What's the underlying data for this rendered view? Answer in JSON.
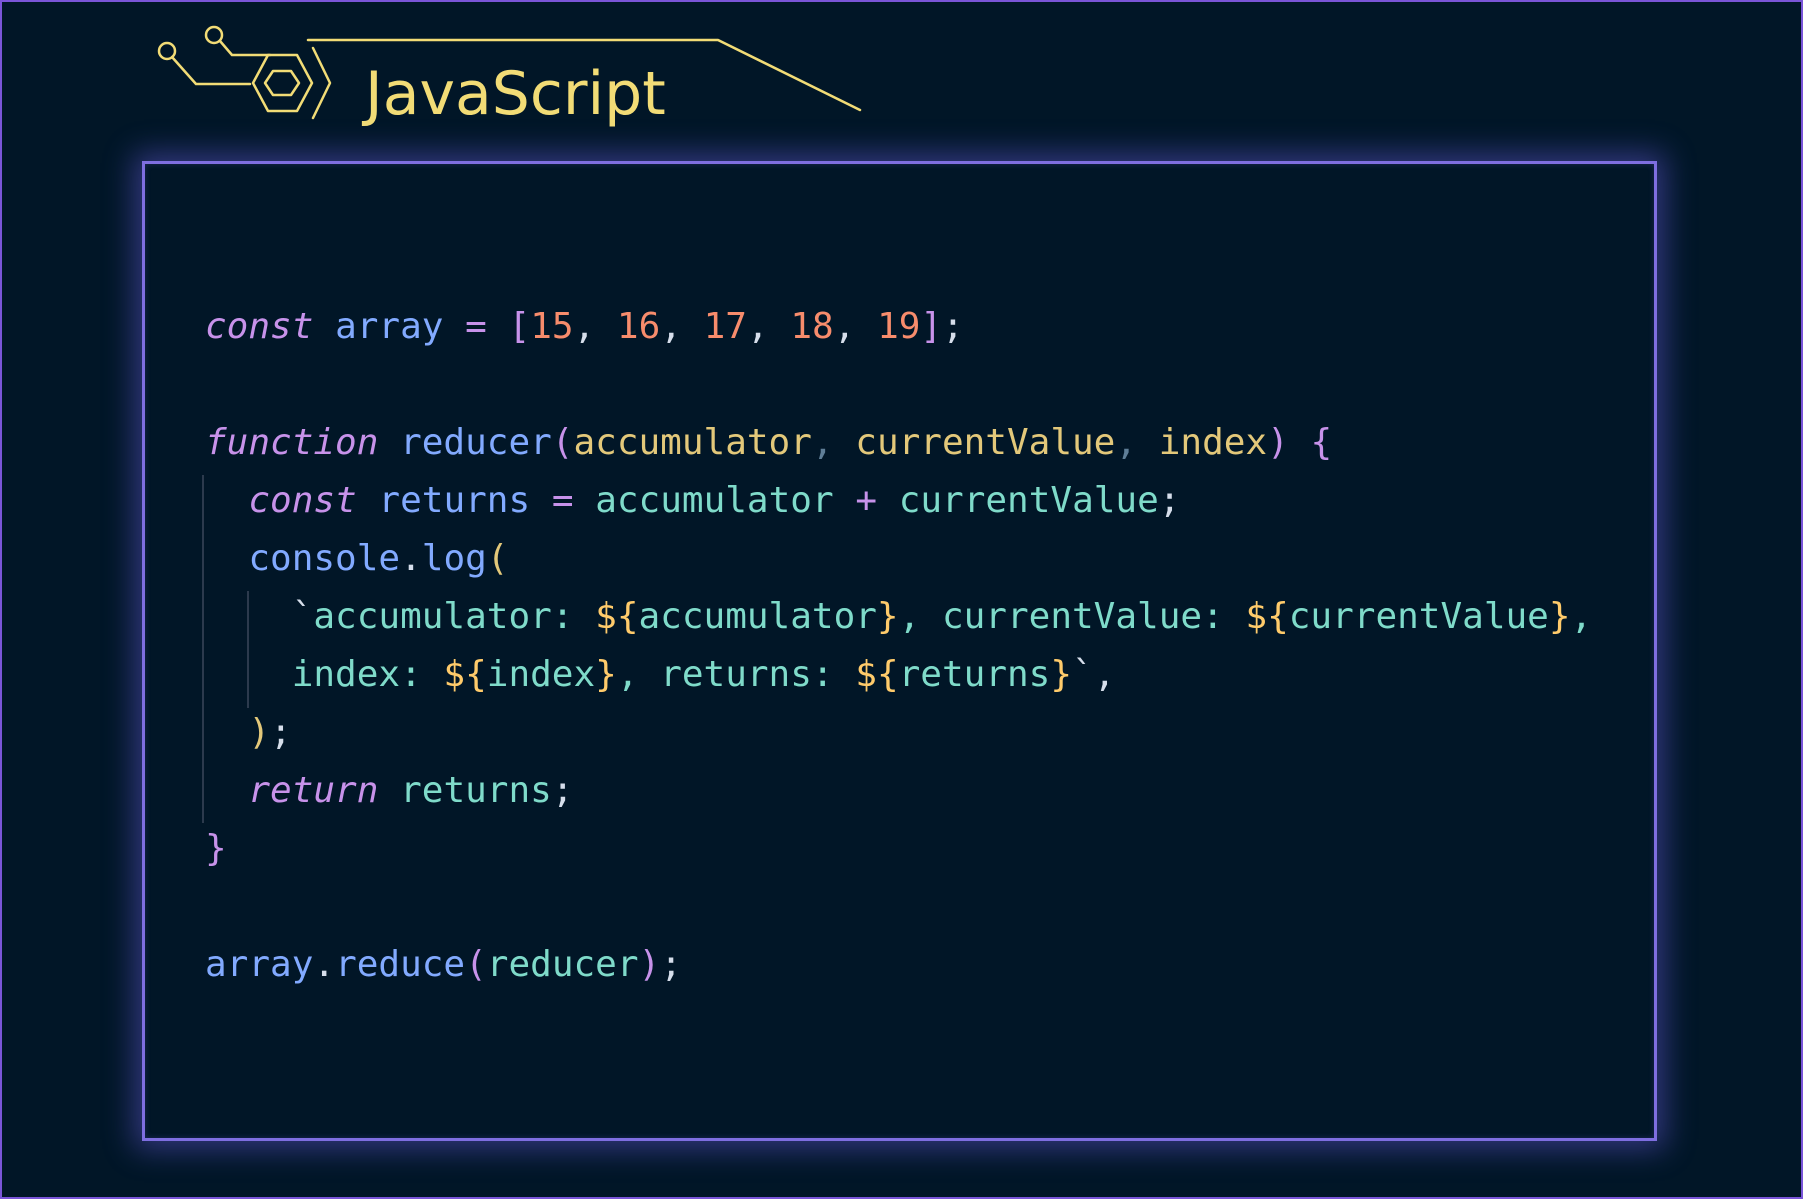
{
  "header": {
    "title": "JavaScript"
  },
  "colors": {
    "background": "#011627",
    "accent_yellow": "#f2dc76",
    "panel_border": "#7e6ee0",
    "keyword": "#c792ea",
    "identifier": "#82aaff",
    "number": "#f78c6c",
    "template": "#7fdbca",
    "interpolation": "#ffcb6b"
  },
  "code": {
    "lines": [
      [
        {
          "cls": "kw",
          "text": "const"
        },
        {
          "cls": "pun",
          "text": " "
        },
        {
          "cls": "var",
          "text": "array"
        },
        {
          "cls": "pun",
          "text": " "
        },
        {
          "cls": "op",
          "text": "="
        },
        {
          "cls": "pun",
          "text": " "
        },
        {
          "cls": "brk",
          "text": "["
        },
        {
          "cls": "num",
          "text": "15"
        },
        {
          "cls": "pun",
          "text": ", "
        },
        {
          "cls": "num",
          "text": "16"
        },
        {
          "cls": "pun",
          "text": ", "
        },
        {
          "cls": "num",
          "text": "17"
        },
        {
          "cls": "pun",
          "text": ", "
        },
        {
          "cls": "num",
          "text": "18"
        },
        {
          "cls": "pun",
          "text": ", "
        },
        {
          "cls": "num",
          "text": "19"
        },
        {
          "cls": "brk",
          "text": "]"
        },
        {
          "cls": "pun",
          "text": ";"
        }
      ],
      [],
      [
        {
          "cls": "kw",
          "text": "function"
        },
        {
          "cls": "pun",
          "text": " "
        },
        {
          "cls": "fn",
          "text": "reducer"
        },
        {
          "cls": "brk",
          "text": "("
        },
        {
          "cls": "par",
          "text": "accumulator"
        },
        {
          "cls": "com",
          "text": ", "
        },
        {
          "cls": "par",
          "text": "currentValue"
        },
        {
          "cls": "com",
          "text": ", "
        },
        {
          "cls": "par",
          "text": "index"
        },
        {
          "cls": "brk",
          "text": ")"
        },
        {
          "cls": "pun",
          "text": " "
        },
        {
          "cls": "brk",
          "text": "{"
        }
      ],
      [
        {
          "cls": "pun",
          "text": "  "
        },
        {
          "cls": "kw",
          "text": "const"
        },
        {
          "cls": "pun",
          "text": " "
        },
        {
          "cls": "var",
          "text": "returns"
        },
        {
          "cls": "pun",
          "text": " "
        },
        {
          "cls": "op",
          "text": "="
        },
        {
          "cls": "pun",
          "text": " "
        },
        {
          "cls": "var2",
          "text": "accumulator"
        },
        {
          "cls": "pun",
          "text": " "
        },
        {
          "cls": "op",
          "text": "+"
        },
        {
          "cls": "pun",
          "text": " "
        },
        {
          "cls": "var2",
          "text": "currentValue"
        },
        {
          "cls": "pun",
          "text": ";"
        }
      ],
      [
        {
          "cls": "pun",
          "text": "  "
        },
        {
          "cls": "obj",
          "text": "console"
        },
        {
          "cls": "pun",
          "text": "."
        },
        {
          "cls": "fn",
          "text": "log"
        },
        {
          "cls": "par",
          "text": "("
        }
      ],
      [
        {
          "cls": "pun",
          "text": "    `"
        },
        {
          "cls": "tpl",
          "text": "accumulator: "
        },
        {
          "cls": "int",
          "text": "${"
        },
        {
          "cls": "tpl",
          "text": "accumulator"
        },
        {
          "cls": "int",
          "text": "}"
        },
        {
          "cls": "tpl",
          "text": ", currentValue: "
        },
        {
          "cls": "int",
          "text": "${"
        },
        {
          "cls": "tpl",
          "text": "currentValue"
        },
        {
          "cls": "int",
          "text": "}"
        },
        {
          "cls": "tpl",
          "text": ","
        }
      ],
      [
        {
          "cls": "tpl",
          "text": "    index: "
        },
        {
          "cls": "int",
          "text": "${"
        },
        {
          "cls": "tpl",
          "text": "index"
        },
        {
          "cls": "int",
          "text": "}"
        },
        {
          "cls": "tpl",
          "text": ", returns: "
        },
        {
          "cls": "int",
          "text": "${"
        },
        {
          "cls": "tpl",
          "text": "returns"
        },
        {
          "cls": "int",
          "text": "}"
        },
        {
          "cls": "pun",
          "text": "`,"
        }
      ],
      [
        {
          "cls": "pun",
          "text": "  "
        },
        {
          "cls": "par",
          "text": ")"
        },
        {
          "cls": "pun",
          "text": ";"
        }
      ],
      [
        {
          "cls": "pun",
          "text": "  "
        },
        {
          "cls": "kw",
          "text": "return"
        },
        {
          "cls": "pun",
          "text": " "
        },
        {
          "cls": "var2",
          "text": "returns"
        },
        {
          "cls": "pun",
          "text": ";"
        }
      ],
      [
        {
          "cls": "brk",
          "text": "}"
        }
      ],
      [],
      [
        {
          "cls": "obj",
          "text": "array"
        },
        {
          "cls": "pun",
          "text": "."
        },
        {
          "cls": "fn",
          "text": "reduce"
        },
        {
          "cls": "brk",
          "text": "("
        },
        {
          "cls": "var2",
          "text": "reducer"
        },
        {
          "cls": "brk",
          "text": ")"
        },
        {
          "cls": "pun",
          "text": ";"
        }
      ]
    ]
  }
}
